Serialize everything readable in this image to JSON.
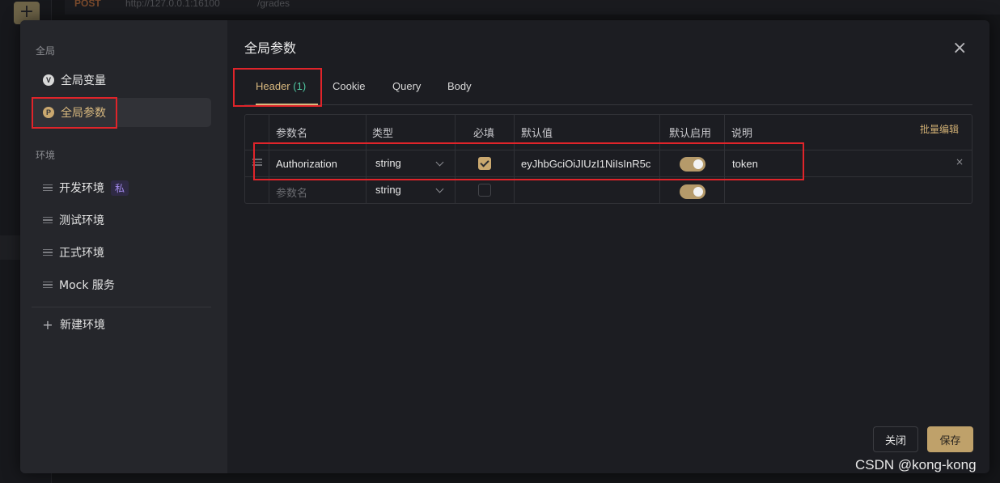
{
  "background": {
    "plus_label": "+",
    "method": "POST",
    "url": "http://127.0.0.1:16100",
    "path": "/grades"
  },
  "sidebar": {
    "section_global": "全局",
    "global_vars": {
      "label": "全局变量",
      "icon_letter": "V"
    },
    "global_params": {
      "label": "全局参数",
      "icon_letter": "P"
    },
    "section_env": "环境",
    "envs": [
      {
        "label": "开发环境",
        "badge": "私"
      },
      {
        "label": "测试环境"
      },
      {
        "label": "正式环境"
      },
      {
        "label": "Mock 服务"
      }
    ],
    "new_env": {
      "plus": "+",
      "label": "新建环境"
    }
  },
  "dialog": {
    "title": "全局参数",
    "close_symbol": "×",
    "tabs": [
      {
        "label": "Header",
        "count": "(1)"
      },
      {
        "label": "Cookie"
      },
      {
        "label": "Query"
      },
      {
        "label": "Body"
      }
    ],
    "batch_edit": "批量编辑",
    "table": {
      "headers": [
        "参数名",
        "类型",
        "必填",
        "默认值",
        "默认启用",
        "说明"
      ],
      "rows": [
        {
          "name": "Authorization",
          "type": "string",
          "required": true,
          "default_value": "eyJhbGciOiJIUzI1NiIsInR5c",
          "enabled": true,
          "description": "token",
          "delete_symbol": "×"
        }
      ],
      "new_row": {
        "name_placeholder": "参数名",
        "type": "string",
        "required": false,
        "enabled": true
      }
    },
    "buttons": {
      "close": "关闭",
      "save": "保存"
    }
  },
  "watermark": "CSDN @kong-kong",
  "colors": {
    "accent": "#d9b97f",
    "count": "#4fc6a0",
    "annotation": "#e0242a",
    "badge": "#a58cf0"
  }
}
